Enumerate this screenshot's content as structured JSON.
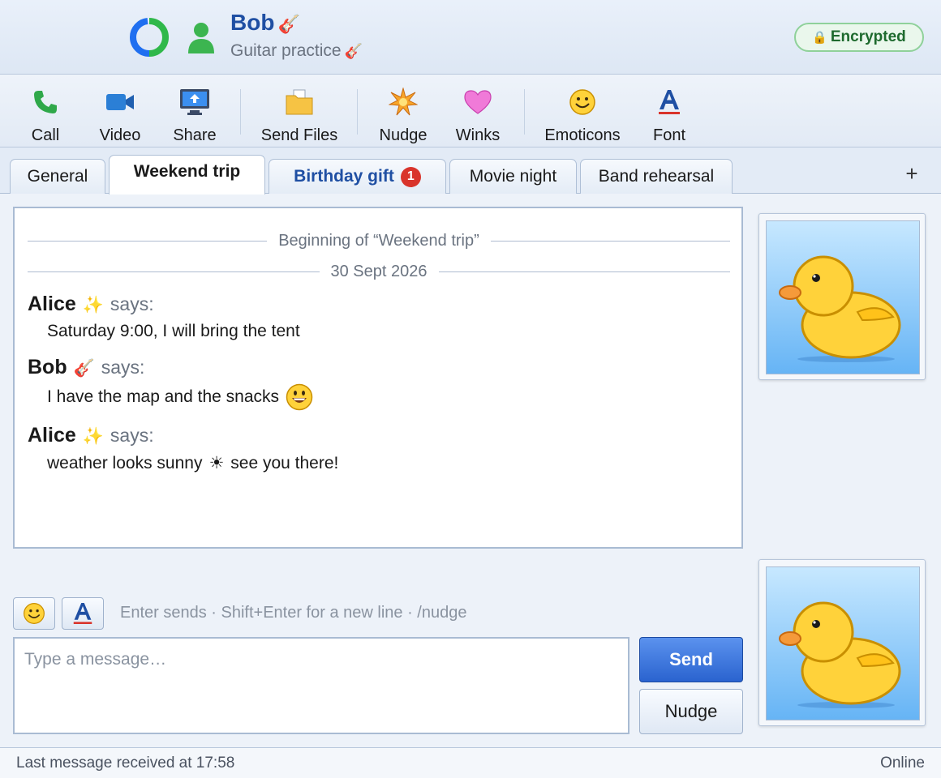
{
  "header": {
    "contact_name": "Bob",
    "contact_name_deco": "🎸",
    "status_message": "Guitar practice",
    "status_deco": "🎸",
    "encryption_label": "Encrypted",
    "encryption_icon": "lock-icon"
  },
  "toolbar": {
    "items": [
      {
        "label": "Call",
        "icon": "phone-icon"
      },
      {
        "label": "Video",
        "icon": "video-camera-icon"
      },
      {
        "label": "Share",
        "icon": "screen-share-icon"
      },
      {
        "label": "Send Files",
        "icon": "folder-icon"
      },
      {
        "label": "Nudge",
        "icon": "nudge-burst-icon"
      },
      {
        "label": "Winks",
        "icon": "heart-icon"
      },
      {
        "label": "Emoticons",
        "icon": "smiley-icon"
      },
      {
        "label": "Font",
        "icon": "font-a-icon"
      }
    ]
  },
  "tabs": {
    "items": [
      {
        "label": "General"
      },
      {
        "label": "Weekend trip",
        "active": true
      },
      {
        "label": "Birthday gift",
        "badge": "1"
      },
      {
        "label": "Movie night"
      },
      {
        "label": "Band rehearsal"
      }
    ],
    "add_label": "+"
  },
  "conversation": {
    "beginning_label": "Beginning of “Weekend trip”",
    "date_label": "30 Sept 2026",
    "says_label": "says:",
    "messages": [
      {
        "sender": "Alice",
        "sender_deco": "✨",
        "text": "Saturday 9:00, I will bring the tent"
      },
      {
        "sender": "Bob",
        "sender_deco": "🎸",
        "text": "I have the map and the snacks",
        "emoji": "grinning-face-icon"
      },
      {
        "sender": "Alice",
        "sender_deco": "✨",
        "text": "weather looks sunny",
        "inline_symbol": "☀",
        "text_after": "see you there!"
      }
    ]
  },
  "avatars": {
    "contact_avatar": "rubber-duck-avatar",
    "self_avatar": "rubber-duck-avatar"
  },
  "composer": {
    "hint": "Enter sends · Shift+Enter for a new line · /nudge",
    "placeholder": "Type a message…",
    "send_label": "Send",
    "nudge_label": "Nudge"
  },
  "statusbar": {
    "last_message": "Last message received at 17:58",
    "presence": "Online"
  },
  "colors": {
    "accent": "#1f4fa3",
    "send_button": "#2a63cf",
    "badge": "#d9342b",
    "encrypted_text": "#1e6a2e"
  }
}
